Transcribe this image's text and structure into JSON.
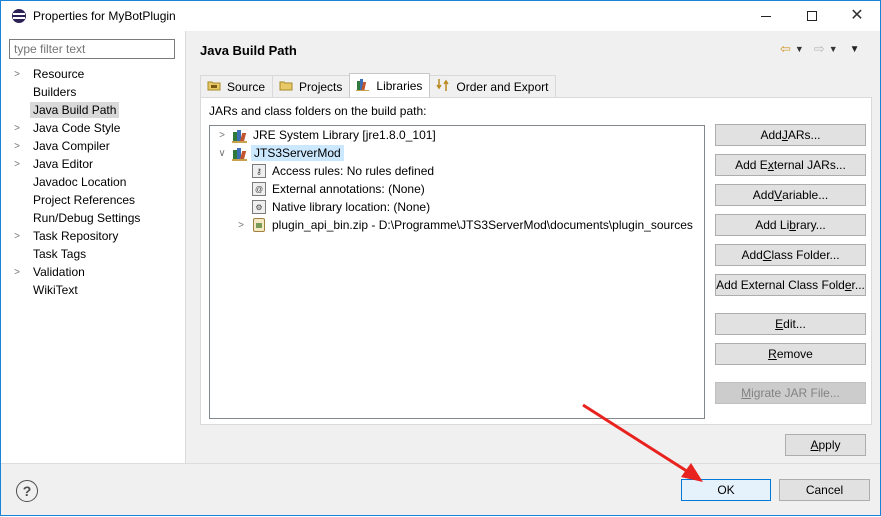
{
  "window": {
    "title": "Properties for MyBotPlugin"
  },
  "filter": {
    "placeholder": "type filter text"
  },
  "sidebar": {
    "items": [
      {
        "label": "Resource",
        "expandable": true
      },
      {
        "label": "Builders",
        "expandable": false
      },
      {
        "label": "Java Build Path",
        "expandable": false,
        "selected": true
      },
      {
        "label": "Java Code Style",
        "expandable": true
      },
      {
        "label": "Java Compiler",
        "expandable": true
      },
      {
        "label": "Java Editor",
        "expandable": true
      },
      {
        "label": "Javadoc Location",
        "expandable": false
      },
      {
        "label": "Project References",
        "expandable": false
      },
      {
        "label": "Run/Debug Settings",
        "expandable": false
      },
      {
        "label": "Task Repository",
        "expandable": true
      },
      {
        "label": "Task Tags",
        "expandable": false
      },
      {
        "label": "Validation",
        "expandable": true
      },
      {
        "label": "WikiText",
        "expandable": false
      }
    ]
  },
  "page": {
    "title": "Java Build Path"
  },
  "tabs": [
    {
      "label": "Source",
      "icon": "source-folder-icon"
    },
    {
      "label": "Projects",
      "icon": "projects-icon"
    },
    {
      "label": "Libraries",
      "icon": "libraries-icon",
      "active": true
    },
    {
      "label": "Order and Export",
      "icon": "order-export-icon"
    }
  ],
  "libraries": {
    "heading": "JARs and class folders on the build path:",
    "tree": {
      "jre": "JRE System Library [jre1.8.0_101]",
      "lib": "JTS3ServerMod",
      "access": "Access rules: No rules defined",
      "annotations": "External annotations: (None)",
      "native": "Native library location: (None)",
      "zip": "plugin_api_bin.zip - D:\\Programme\\JTS3ServerMod\\documents\\plugin_sources"
    },
    "buttons": {
      "add_jars": {
        "pre": "Add ",
        "key": "J",
        "post": "ARs..."
      },
      "add_external_jars": {
        "pre": "Add E",
        "key": "x",
        "post": "ternal JARs..."
      },
      "add_variable": {
        "pre": "Add ",
        "key": "V",
        "post": "ariable..."
      },
      "add_library": {
        "pre": "Add Li",
        "key": "b",
        "post": "rary..."
      },
      "add_class_folder": {
        "pre": "Add ",
        "key": "C",
        "post": "lass Folder..."
      },
      "add_external_class_folder": {
        "pre": "Add External Class Fold",
        "key": "e",
        "post": "r..."
      },
      "edit": {
        "pre": "",
        "key": "E",
        "post": "dit..."
      },
      "remove": {
        "pre": "",
        "key": "R",
        "post": "emove"
      },
      "migrate": {
        "pre": "",
        "key": "M",
        "post": "igrate JAR File..."
      }
    }
  },
  "apply": {
    "pre": "",
    "key": "A",
    "post": "pply"
  },
  "footer": {
    "ok_label": "OK",
    "cancel_label": "Cancel",
    "help_glyph": "?"
  },
  "colors": {
    "accent": "#0078d7",
    "annotation_arrow": "#e8231f",
    "selection": "#cce8ff"
  }
}
